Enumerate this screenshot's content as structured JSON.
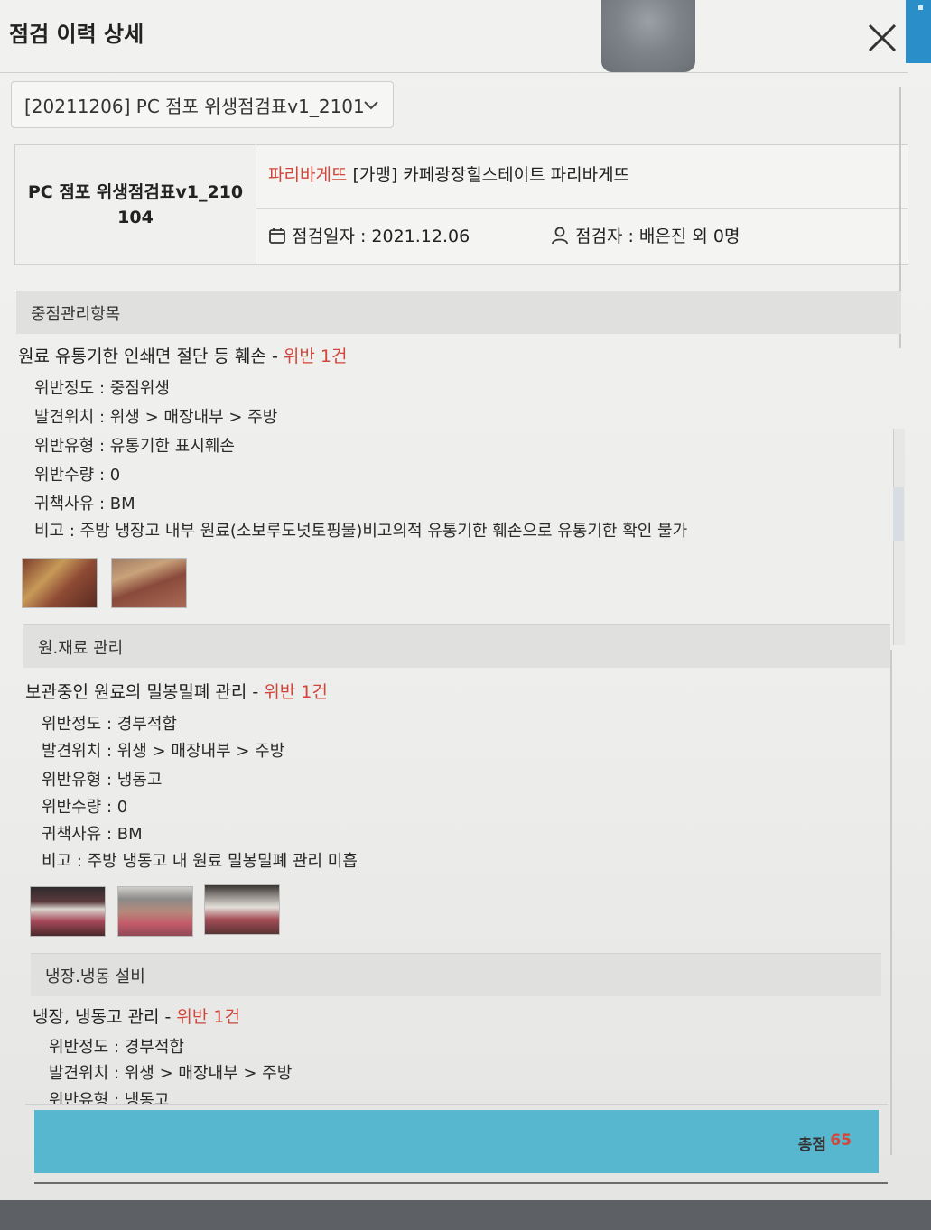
{
  "header": {
    "title": "점검 이력 상세"
  },
  "select": {
    "value": "[20211206] PC 점포 위생점검표v1_2101"
  },
  "info": {
    "checklist_name": "PC 점포 위생점검표v1_210104",
    "brand": "파리바게뜨",
    "store": " [가맹] 카페광장힐스테이트 파리바게뜨",
    "date_label": "점검일자 : 2021.12.06",
    "inspector_label": "점검자 : 배은진 외 0명"
  },
  "sections": [
    {
      "header": "중점관리항목",
      "item_title": "원료 유통기한 인쇄면 절단 등 훼손 - ",
      "violation": "위반 1건",
      "details": [
        "위반정도 : 중점위생",
        "발견위치 : 위생 > 매장내부 > 주방",
        "위반유형 : 유통기한 표시훼손",
        "위반수량 : 0",
        "귀책사유 : BM",
        "비고 : 주방 냉장고 내부 원료(소보루도넛토핑물)비고의적 유통기한 훼손으로 유통기한 확인 불가"
      ]
    },
    {
      "header": "원.재료 관리",
      "item_title": "보관중인 원료의 밀봉밀폐 관리 - ",
      "violation": "위반 1건",
      "details": [
        "위반정도 : 경부적합",
        "발견위치 : 위생 > 매장내부 > 주방",
        "위반유형 : 냉동고",
        "위반수량 : 0",
        "귀책사유 : BM",
        "비고 : 주방 냉동고 내 원료 밀봉밀폐 관리 미흡"
      ]
    },
    {
      "header": "냉장.냉동 설비",
      "item_title": "냉장, 냉동고 관리 - ",
      "violation": "위반 1건",
      "details": [
        "위반정도 : 경부적합",
        "발견위치 : 위생 > 매장내부 > 주방",
        "위반유형 : 냉동고"
      ]
    }
  ],
  "total": {
    "label": "총점",
    "value": "65"
  },
  "colors": {
    "violation": "#d0463a",
    "total_bar": "#56b7cf",
    "side_tab": "#2a8fc9"
  },
  "icons": {
    "close": "close-icon",
    "dropdown": "chevron-down-icon",
    "calendar": "calendar-icon",
    "user": "user-icon"
  }
}
